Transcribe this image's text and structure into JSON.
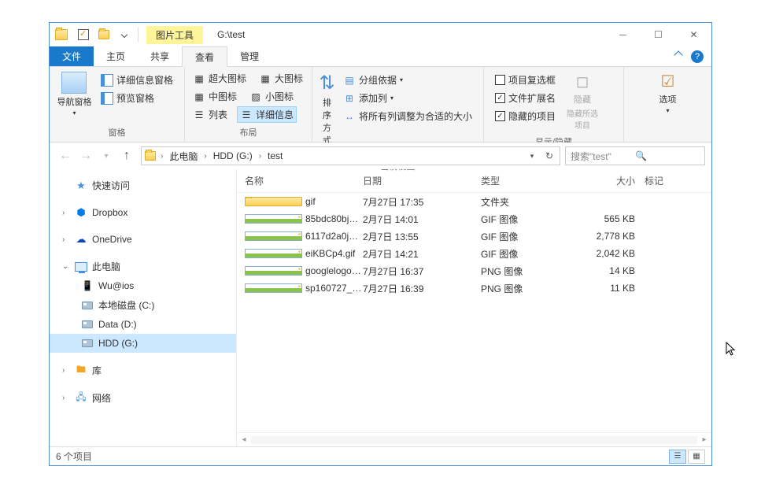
{
  "title_path": "G:\\test",
  "context_tab": "图片工具",
  "tabs": {
    "file": "文件",
    "home": "主页",
    "share": "共享",
    "view": "查看",
    "manage": "管理"
  },
  "ribbon": {
    "panes_group": {
      "nav_pane": "导航窗格",
      "detail_pane": "详细信息窗格",
      "preview_pane": "预览窗格",
      "label": "窗格"
    },
    "layout_group": {
      "xl_icon": "超大图标",
      "l_icon": "大图标",
      "m_icon": "中图标",
      "s_icon": "小图标",
      "list": "列表",
      "details": "详细信息",
      "label": "布局"
    },
    "view_group": {
      "sort": "排序方式",
      "group_by": "分组依据",
      "add_col": "添加列",
      "fit_cols": "将所有列调整为合适的大小",
      "label": "当前视图"
    },
    "showhide_group": {
      "item_check": "项目复选框",
      "ext": "文件扩展名",
      "hidden": "隐藏的项目",
      "hide_sel": "隐藏所选项目",
      "hide_btn": "隐藏",
      "label": "显示/隐藏"
    },
    "options": "选项"
  },
  "breadcrumb": {
    "root": "此电脑",
    "drive": "HDD (G:)",
    "folder": "test"
  },
  "search_placeholder": "搜索\"test\"",
  "sidebar": {
    "quick": "快速访问",
    "dropbox": "Dropbox",
    "onedrive": "OneDrive",
    "this_pc": "此电脑",
    "wu": "Wu@ios",
    "c": "本地磁盘 (C:)",
    "d": "Data (D:)",
    "g": "HDD (G:)",
    "lib": "库",
    "net": "网络"
  },
  "columns": {
    "name": "名称",
    "date": "日期",
    "type": "类型",
    "size": "大小",
    "tag": "标记"
  },
  "rows": [
    {
      "icon": "folder",
      "name": "gif",
      "date": "7月27日 17:35",
      "type": "文件夹",
      "size": ""
    },
    {
      "icon": "img",
      "name": "85bdc80bjw1ebqf...",
      "date": "2月7日 14:01",
      "type": "GIF 图像",
      "size": "565 KB"
    },
    {
      "icon": "img",
      "name": "6117d2a0jw1dp9...",
      "date": "2月7日 13:55",
      "type": "GIF 图像",
      "size": "2,778 KB"
    },
    {
      "icon": "img",
      "name": "eiKBCp4.gif",
      "date": "2月7日 14:21",
      "type": "GIF 图像",
      "size": "2,042 KB"
    },
    {
      "icon": "img",
      "name": "googlelogo_color...",
      "date": "7月27日 16:37",
      "type": "PNG 图像",
      "size": "14 KB"
    },
    {
      "icon": "img",
      "name": "sp160727_163853...",
      "date": "7月27日 16:39",
      "type": "PNG 图像",
      "size": "11 KB"
    }
  ],
  "status": "6 个项目"
}
